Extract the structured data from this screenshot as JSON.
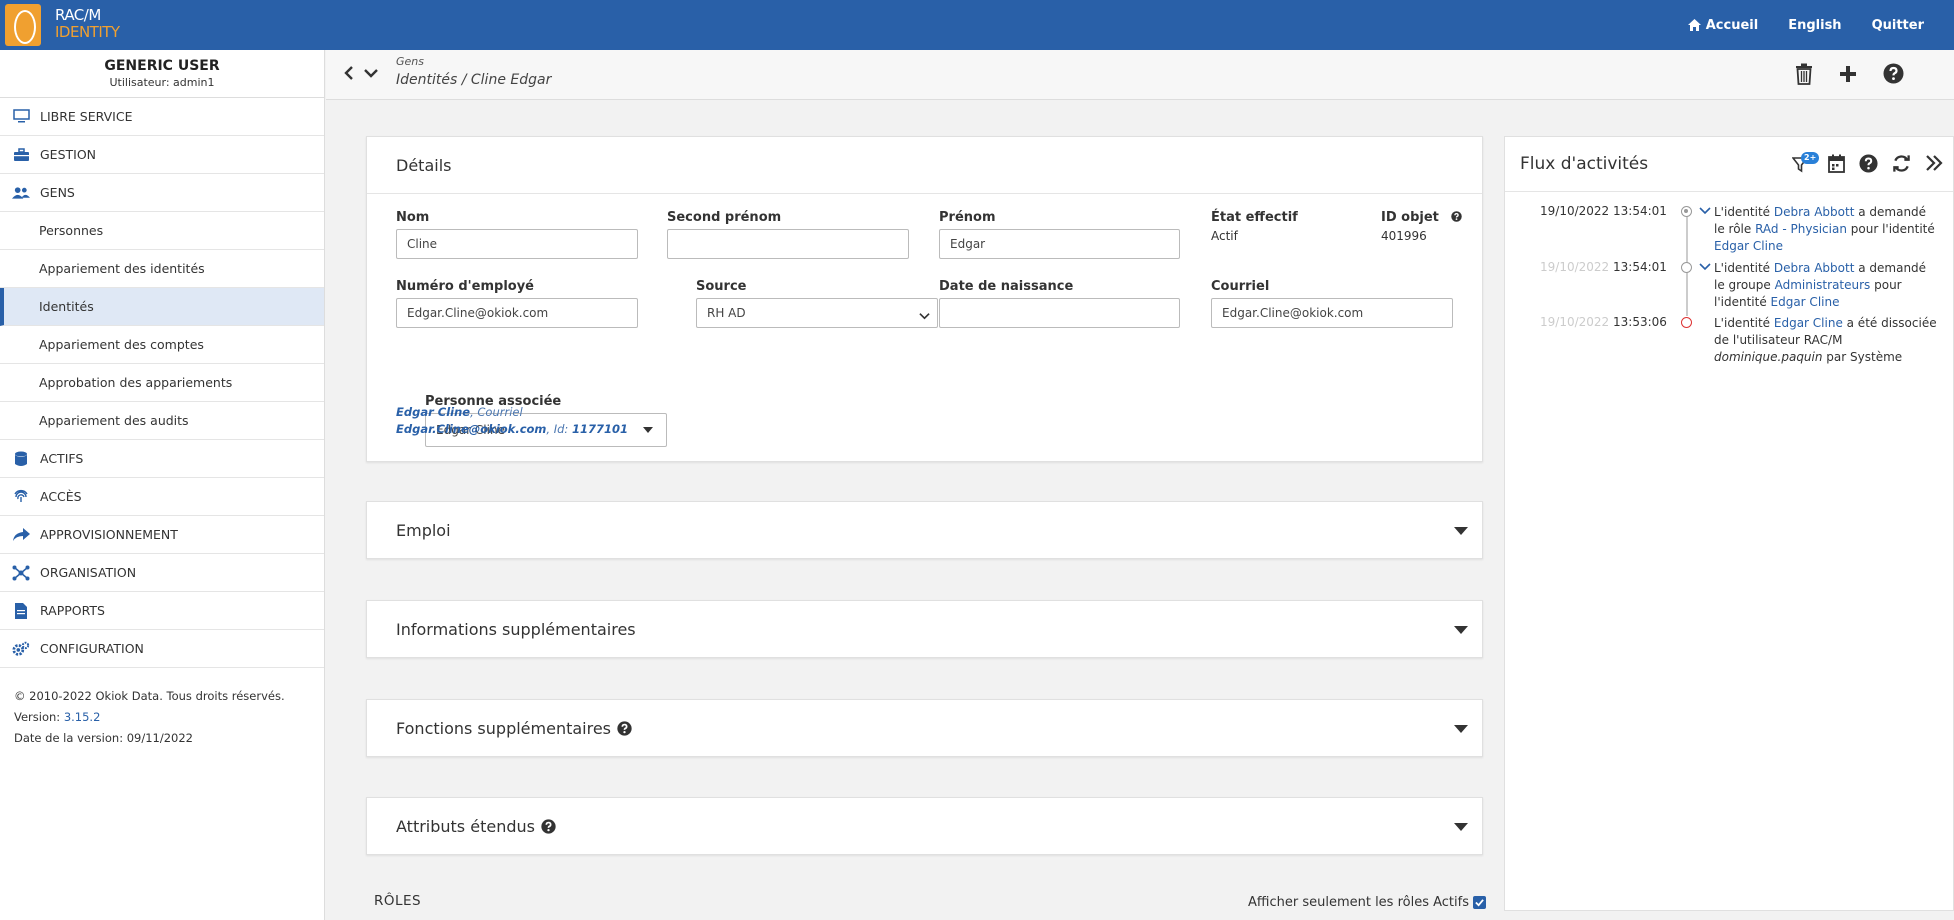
{
  "app": {
    "brand_line1": "RAC/M",
    "brand_line2": "IDENTITY"
  },
  "topnav": {
    "home": "Accueil",
    "language": "English",
    "quit": "Quitter"
  },
  "user": {
    "name": "GENERIC USER",
    "login": "Utilisateur: admin1"
  },
  "sidebar": {
    "libre_service": "LIBRE SERVICE",
    "gestion": "GESTION",
    "gens": "GENS",
    "sub": [
      "Personnes",
      "Appariement des identités",
      "Identités",
      "Appariement des comptes",
      "Approbation des appariements",
      "Appariement des audits"
    ],
    "actifs": "ACTIFS",
    "acces": "ACCÈS",
    "approvisionnement": "APPROVISIONNEMENT",
    "organisation": "ORGANISATION",
    "rapports": "RAPPORTS",
    "configuration": "CONFIGURATION"
  },
  "footer": {
    "copyright": "© 2010-2022 Okiok Data. Tous droits réservés.",
    "version_label": "Version:",
    "version": "3.15.2",
    "date": "Date de la version: 09/11/2022"
  },
  "header": {
    "crumb_top": "Gens",
    "crumb": "Identités / Cline Edgar"
  },
  "details": {
    "title": "Détails",
    "nom_label": "Nom",
    "nom": "Cline",
    "second_label": "Second prénom",
    "second": "",
    "prenom_label": "Prénom",
    "prenom": "Edgar",
    "etat_label": "État effectif",
    "etat": "Actif",
    "id_label": "ID objet",
    "id": "401996",
    "emp_label": "Numéro d'employé",
    "emp": "Edgar.Cline@okiok.com",
    "source_label": "Source",
    "source": "RH AD",
    "dob_label": "Date de naissance",
    "dob": "",
    "courriel_label": "Courriel",
    "courriel": "Edgar.Cline@okiok.com",
    "assoc_label": "Personne associée",
    "assoc": "Edgar Cline",
    "assoc_name": "Edgar Cline",
    "assoc_name_suffix": ", Courriel",
    "assoc_email": "Edgar.Cline@okiok.com",
    "assoc_id_label": ", Id: ",
    "assoc_id": "1177101"
  },
  "sections": {
    "emploi": "Emploi",
    "info": "Informations supplémentaires",
    "fonctions": "Fonctions supplémentaires",
    "attributs": "Attributs étendus"
  },
  "roles": {
    "title": "RÔLES",
    "toggle": "Afficher seulement les rôles Actifs"
  },
  "activity": {
    "title": "Flux d'activités",
    "filter_badge": "2+",
    "events": [
      {
        "date": "19/10/2022",
        "time": "13:54:01",
        "t1": "L'identité ",
        "l1": "Debra Abbott",
        "t2": " a demandé le rôle ",
        "l2": "RAd - Physician",
        "t3": " pour l'identité ",
        "l3": "Edgar Cline"
      },
      {
        "date": "19/10/2022",
        "time": "13:54:01",
        "t1": "L'identité ",
        "l1": "Debra Abbott",
        "t2": " a demandé le groupe ",
        "l2": "Administrateurs",
        "t3": " pour l'identité ",
        "l3": "Edgar Cline"
      },
      {
        "date": "19/10/2022",
        "time": "13:53:06",
        "t1": "L'identité ",
        "l1": "Edgar Cline",
        "t2": " a été dissociée de l'utilisateur RAC/M ",
        "i1": "dominique.paquin",
        "t3": " par Système"
      }
    ]
  },
  "colors": {
    "primary": "#2960a8",
    "accent": "#f0a030",
    "danger": "#d33333"
  }
}
